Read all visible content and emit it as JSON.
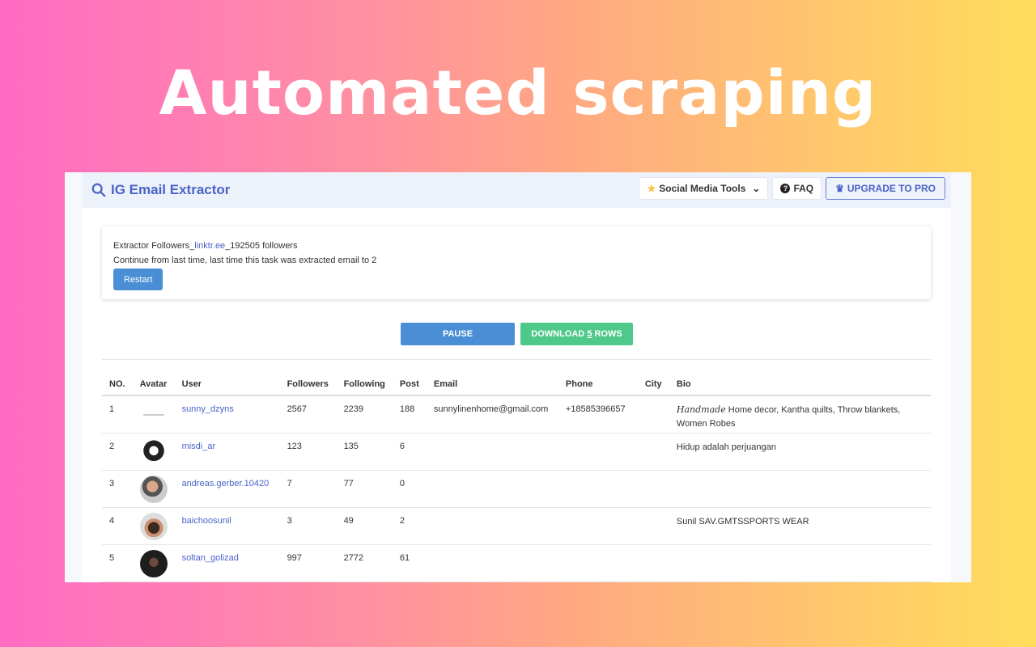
{
  "headline": "Automated scraping",
  "app": {
    "title": "IG Email Extractor",
    "nav": {
      "tools": "Social Media Tools",
      "faq": "FAQ",
      "pro": "UPGRADE TO PRO"
    }
  },
  "task": {
    "prefix": "Extractor Followers_",
    "link": "linktr.ee",
    "suffix": "_192505 followers",
    "status": "Continue from last time, last time this task was extracted email to 2",
    "restart": "Restart"
  },
  "actions": {
    "pause": "PAUSE",
    "download_pre": "DOWNLOAD ",
    "download_count": "5",
    "download_post": " ROWS"
  },
  "table": {
    "headers": [
      "NO.",
      "Avatar",
      "User",
      "Followers",
      "Following",
      "Post",
      "Email",
      "Phone",
      "City",
      "Bio"
    ],
    "rows": [
      {
        "no": "1",
        "user": "sunny_dzyns",
        "followers": "2567",
        "following": "2239",
        "post": "188",
        "email": "sunnylinenhome@gmail.com",
        "phone": "+18585396657",
        "city": "",
        "bio_em": "Handmade",
        "bio": " Home decor, Kantha quilts, Throw blankets, Women Robes"
      },
      {
        "no": "2",
        "user": "misdi_ar",
        "followers": "123",
        "following": "135",
        "post": "6",
        "email": "",
        "phone": "",
        "city": "",
        "bio_em": "",
        "bio": "Hidup adalah perjuangan"
      },
      {
        "no": "3",
        "user": "andreas.gerber.10420",
        "followers": "7",
        "following": "77",
        "post": "0",
        "email": "",
        "phone": "",
        "city": "",
        "bio_em": "",
        "bio": ""
      },
      {
        "no": "4",
        "user": "baichoosunil",
        "followers": "3",
        "following": "49",
        "post": "2",
        "email": "",
        "phone": "",
        "city": "",
        "bio_em": "",
        "bio": "Sunil SAV.GMTSSPORTS WEAR"
      },
      {
        "no": "5",
        "user": "soltan_golizad",
        "followers": "997",
        "following": "2772",
        "post": "61",
        "email": "",
        "phone": "",
        "city": "",
        "bio_em": "",
        "bio": ""
      }
    ]
  },
  "colors": {
    "accent": "#4a63c8",
    "pause": "#4a8fd6",
    "download": "#4fc98a"
  }
}
